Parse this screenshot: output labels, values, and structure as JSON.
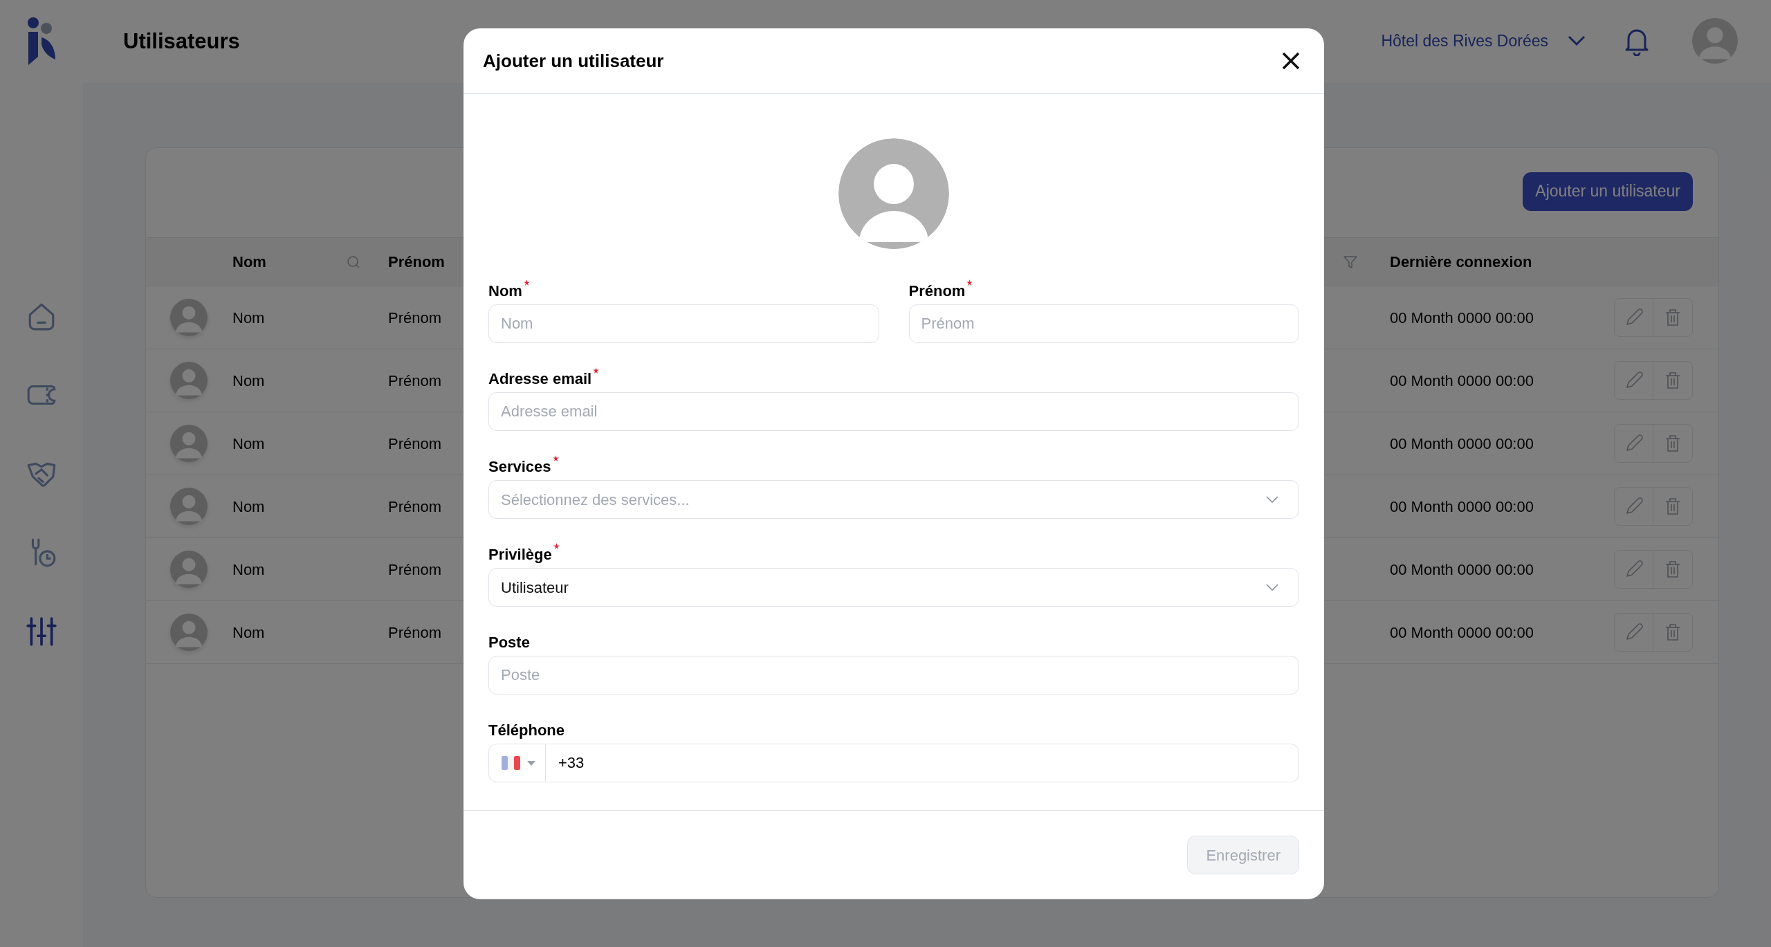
{
  "header": {
    "page_title": "Utilisateurs",
    "hotel": "Hôtel des Rives Dorées"
  },
  "sidebar": {
    "items": [
      {
        "kind": "home",
        "selected": false
      },
      {
        "kind": "ticket",
        "selected": false
      },
      {
        "kind": "handshake",
        "selected": false
      },
      {
        "kind": "maintenance",
        "selected": false
      },
      {
        "kind": "settings",
        "selected": true
      }
    ]
  },
  "toolbar": {
    "add_button": "Ajouter un utilisateur"
  },
  "table": {
    "columns": [
      {
        "label": "Nom",
        "kind": "search"
      },
      {
        "label": "Prénom",
        "kind": "plain"
      },
      {
        "kind": "filter"
      },
      {
        "label": "Dernière connexion",
        "kind": "plain"
      }
    ],
    "rows": [
      {
        "nom": "Nom",
        "prenom": "Prénom",
        "last_login": "00 Month 0000 00:00"
      },
      {
        "nom": "Nom",
        "prenom": "Prénom",
        "last_login": "00 Month 0000 00:00"
      },
      {
        "nom": "Nom",
        "prenom": "Prénom",
        "last_login": "00 Month 0000 00:00"
      },
      {
        "nom": "Nom",
        "prenom": "Prénom",
        "last_login": "00 Month 0000 00:00"
      },
      {
        "nom": "Nom",
        "prenom": "Prénom",
        "last_login": "00 Month 0000 00:00"
      },
      {
        "nom": "Nom",
        "prenom": "Prénom",
        "last_login": "00 Month 0000 00:00"
      }
    ]
  },
  "modal": {
    "title": "Ajouter un utilisateur",
    "field_rows": [
      [
        {
          "label": "Nom",
          "required": true,
          "kind": "text",
          "placeholder": "Nom"
        },
        {
          "label": "Prénom",
          "required": true,
          "kind": "text",
          "placeholder": "Prénom"
        }
      ],
      [
        {
          "label": "Adresse email",
          "required": true,
          "kind": "text",
          "placeholder": "Adresse email"
        }
      ],
      [
        {
          "label": "Services",
          "required": true,
          "kind": "select",
          "placeholder": "Sélectionnez des services..."
        }
      ],
      [
        {
          "label": "Privilège",
          "required": true,
          "kind": "select",
          "value": "Utilisateur"
        }
      ],
      [
        {
          "label": "Poste",
          "required": false,
          "kind": "text",
          "placeholder": "Poste"
        }
      ],
      [
        {
          "label": "Téléphone",
          "required": false,
          "kind": "phone",
          "value": "+33"
        }
      ]
    ],
    "save_button": {
      "label": "Enregistrer",
      "disabled": true
    }
  }
}
